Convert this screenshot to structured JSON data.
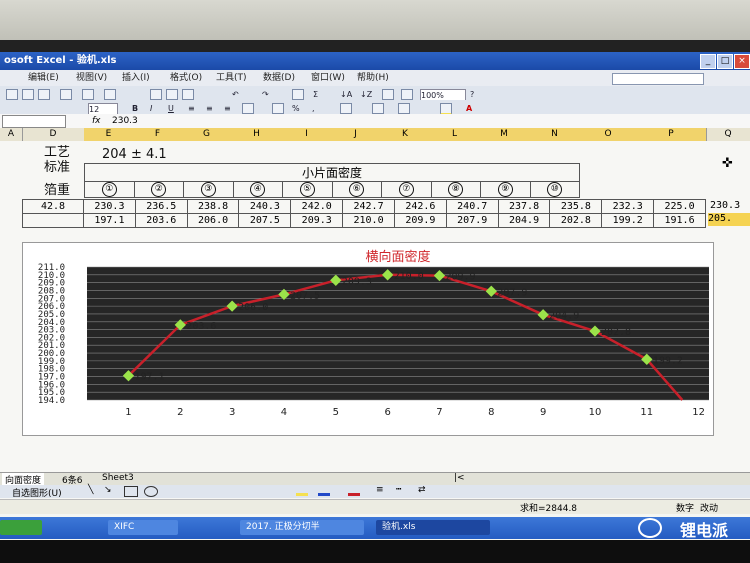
{
  "window": {
    "title": "osoft Excel - 验机.xls"
  },
  "menu": [
    "编辑(E)",
    "视图(V)",
    "插入(I)",
    "格式(O)",
    "工具(T)",
    "数据(D)",
    "窗口(W)",
    "帮助(H)"
  ],
  "toolbar": {
    "font_size": "12",
    "zoom": "100%"
  },
  "formula_bar": {
    "name_box": "",
    "fx": "fx",
    "value": "230.3"
  },
  "columns": [
    "A",
    "D",
    "E",
    "F",
    "G",
    "H",
    "I",
    "J",
    "K",
    "L",
    "M",
    "N",
    "O",
    "P",
    "Q"
  ],
  "sheet": {
    "process_label": "工艺",
    "standard_label": "标准",
    "standard_value": "204 ± 4.1",
    "foil_weight_label": "箔重",
    "small_density_header": "小片面密度",
    "piece_numbers": [
      "①",
      "②",
      "③",
      "④",
      "⑤",
      "⑥",
      "⑦",
      "⑧",
      "⑨",
      "⑩"
    ],
    "foil_weight_value": "42.8",
    "row1": [
      "230.3",
      "236.5",
      "238.8",
      "240.3",
      "242.0",
      "242.7",
      "242.6",
      "240.7",
      "237.8",
      "235.8",
      "232.3",
      "225.0"
    ],
    "row2": [
      "197.1",
      "203.6",
      "206.0",
      "207.5",
      "209.3",
      "210.0",
      "209.9",
      "207.9",
      "204.9",
      "202.8",
      "199.2",
      "191.6"
    ],
    "overflow_q1": "230.3",
    "overflow_q2": "205."
  },
  "chart_data": {
    "type": "line",
    "title": "横向面密度",
    "x": [
      1,
      2,
      3,
      4,
      5,
      6,
      7,
      8,
      9,
      10,
      11,
      12
    ],
    "x_ticks": [
      "1",
      "2",
      "3",
      "4",
      "5",
      "6",
      "7",
      "8",
      "9",
      "10",
      "11",
      "12"
    ],
    "y_ticks": [
      "194.0",
      "195.0",
      "196.0",
      "197.0",
      "198.0",
      "199.0",
      "200.0",
      "201.0",
      "202.0",
      "203.0",
      "204.0",
      "205.0",
      "206.0",
      "207.0",
      "208.0",
      "209.0",
      "210.0",
      "211.0"
    ],
    "ylim": [
      194,
      211
    ],
    "series": [
      {
        "values": [
          197.1,
          203.6,
          206.0,
          207.5,
          209.3,
          210.0,
          209.9,
          207.9,
          204.9,
          202.8,
          199.2,
          191.6
        ]
      }
    ],
    "data_labels": [
      "197.1",
      "203.6",
      "206.0",
      "207.5",
      "209.3",
      "210.0",
      "209.9",
      "207.9",
      "204.9",
      "202.8",
      "199.2",
      ""
    ],
    "line_color": "#c8202a",
    "marker_color": "#9be34a",
    "plot_background": "#262626",
    "grid": true
  },
  "tabs": {
    "sheet1": "向面密度",
    "sheet2": "6条6",
    "sheet3": "Sheet3"
  },
  "drawing_toolbar": {
    "label": "自选图形(U)"
  },
  "status": {
    "sum": "求和=2844.8",
    "mode1": "数字",
    "mode2": "改动"
  },
  "taskbar": {
    "item1": "XIFC",
    "item2": "2017. 正极分切半",
    "item3": "验机.xls"
  },
  "watermark": "锂电派",
  "colors": {
    "accent_red": "#d0282d",
    "cell_selected": "#f5d352",
    "taskbar_blue": "#2e66cc"
  }
}
